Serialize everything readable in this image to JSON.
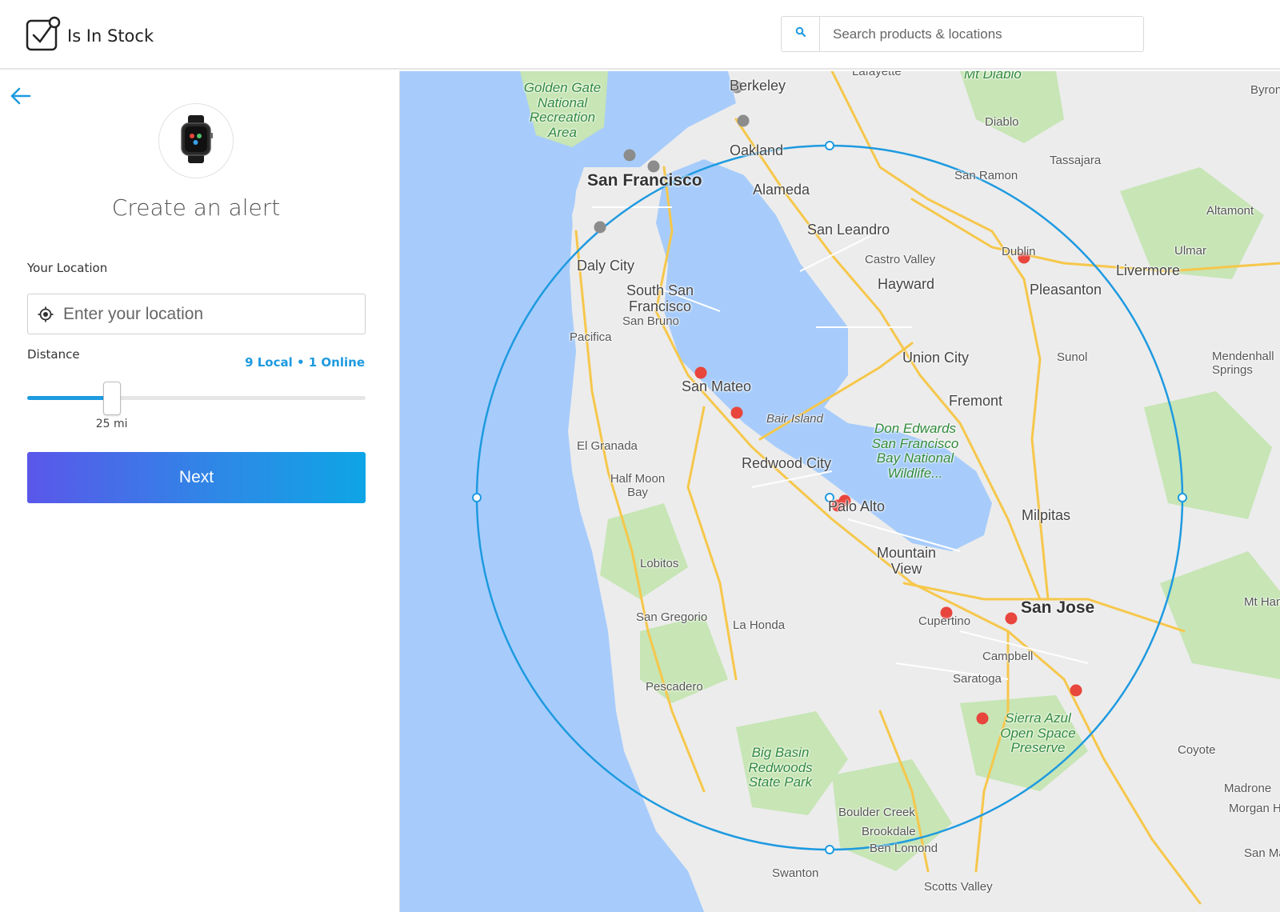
{
  "header": {
    "app_name": "Is In Stock",
    "search_placeholder": "Search products & locations",
    "search_icon": "search-icon",
    "logo_icon": "checkbox-logo-icon"
  },
  "panel": {
    "back_icon": "arrow-left-icon",
    "product_image": "smartwatch-image",
    "title": "Create an alert",
    "location_label": "Your Location",
    "location_placeholder": "Enter your location",
    "location_icon": "crosshair-icon",
    "distance_label": "Distance",
    "availability": "9 Local • 1 Online",
    "distance_fraction": 0.25,
    "distance_value": "25 mi",
    "next_label": "Next"
  },
  "map": {
    "places": [
      {
        "name": "Lafayette",
        "cls": ""
      },
      {
        "name": "Mt Diablo",
        "cls": "park"
      },
      {
        "name": "Byron",
        "cls": ""
      },
      {
        "name": "Golden Gate National Recreation Area",
        "cls": "park"
      },
      {
        "name": "Berkeley",
        "cls": "med"
      },
      {
        "name": "Diablo",
        "cls": ""
      },
      {
        "name": "Oakland",
        "cls": "med"
      },
      {
        "name": "Tassajara",
        "cls": ""
      },
      {
        "name": "San Francisco",
        "cls": "big"
      },
      {
        "name": "San Ramon",
        "cls": ""
      },
      {
        "name": "Alameda",
        "cls": "med"
      },
      {
        "name": "Altamont",
        "cls": ""
      },
      {
        "name": "San Leandro",
        "cls": "med"
      },
      {
        "name": "Dublin",
        "cls": ""
      },
      {
        "name": "Ulmar",
        "cls": ""
      },
      {
        "name": "Castro Valley",
        "cls": ""
      },
      {
        "name": "Livermore",
        "cls": "med"
      },
      {
        "name": "Daly City",
        "cls": "med"
      },
      {
        "name": "Hayward",
        "cls": "med"
      },
      {
        "name": "Pleasanton",
        "cls": "med"
      },
      {
        "name": "South San Francisco",
        "cls": "med"
      },
      {
        "name": "San Bruno",
        "cls": ""
      },
      {
        "name": "Pacifica",
        "cls": ""
      },
      {
        "name": "Union City",
        "cls": "med"
      },
      {
        "name": "Sunol",
        "cls": ""
      },
      {
        "name": "Mendenhall Springs",
        "cls": ""
      },
      {
        "name": "San Mateo",
        "cls": "med"
      },
      {
        "name": "Fremont",
        "cls": "med"
      },
      {
        "name": "Bair Island",
        "cls": ""
      },
      {
        "name": "Don Edwards San Francisco Bay National Wildlife...",
        "cls": "park"
      },
      {
        "name": "El Granada",
        "cls": ""
      },
      {
        "name": "Redwood City",
        "cls": "med"
      },
      {
        "name": "Half Moon Bay",
        "cls": ""
      },
      {
        "name": "Palo Alto",
        "cls": "med"
      },
      {
        "name": "Milpitas",
        "cls": "med"
      },
      {
        "name": "Mountain View",
        "cls": "med"
      },
      {
        "name": "Lobitos",
        "cls": ""
      },
      {
        "name": "Mt Hamilton",
        "cls": ""
      },
      {
        "name": "San Jose",
        "cls": "big"
      },
      {
        "name": "San Gregorio",
        "cls": ""
      },
      {
        "name": "La Honda",
        "cls": ""
      },
      {
        "name": "Cupertino",
        "cls": ""
      },
      {
        "name": "Campbell",
        "cls": ""
      },
      {
        "name": "Saratoga",
        "cls": ""
      },
      {
        "name": "Pescadero",
        "cls": ""
      },
      {
        "name": "Sierra Azul Open Space Preserve",
        "cls": "park"
      },
      {
        "name": "Coyote",
        "cls": ""
      },
      {
        "name": "Big Basin Redwoods State Park",
        "cls": "park"
      },
      {
        "name": "Madrone",
        "cls": ""
      },
      {
        "name": "Morgan Hill",
        "cls": ""
      },
      {
        "name": "Boulder Creek",
        "cls": ""
      },
      {
        "name": "Brookdale",
        "cls": ""
      },
      {
        "name": "Ben Lomond",
        "cls": ""
      },
      {
        "name": "San Martin",
        "cls": ""
      },
      {
        "name": "Swanton",
        "cls": ""
      },
      {
        "name": "Scotts Valley",
        "cls": ""
      }
    ],
    "pin_color_in_range": "#e8453c",
    "pin_color_out_range": "#8c8c8c",
    "radius_color": "#1e9ae0"
  }
}
